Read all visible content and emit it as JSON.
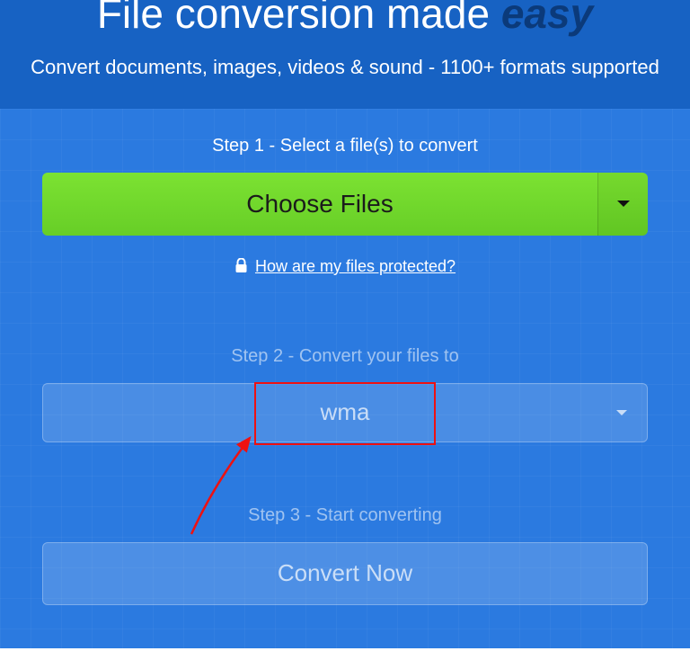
{
  "hero": {
    "title_main": "File conversion made ",
    "title_easy": "easy",
    "subtitle": "Convert documents, images, videos & sound - 1100+ formats supported"
  },
  "step1": {
    "label": "Step 1 - Select a file(s) to convert",
    "button": "Choose Files",
    "protect_link": "How are my files protected?"
  },
  "step2": {
    "label": "Step 2 - Convert your files to",
    "selected_format": "wma"
  },
  "step3": {
    "label": "Step 3 - Start converting",
    "button": "Convert Now"
  }
}
